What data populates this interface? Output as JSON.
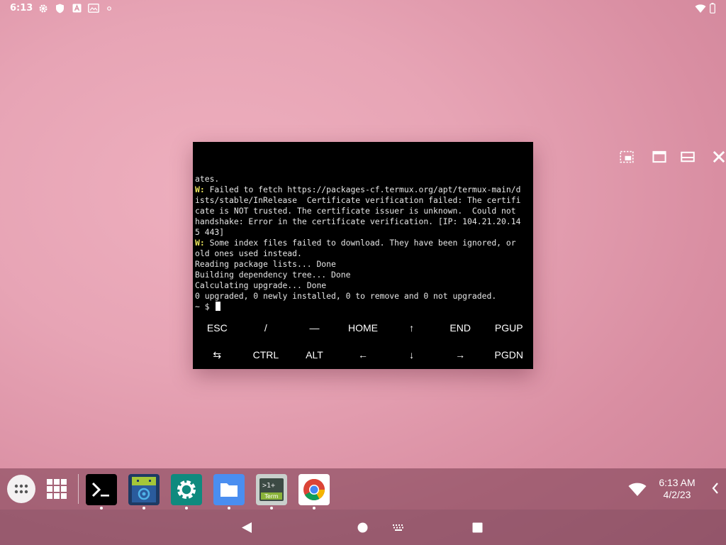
{
  "status_bar": {
    "time": "6:13",
    "icons": [
      "gear-icon",
      "shield-icon",
      "a-icon",
      "image-icon",
      "dot-icon",
      "wifi-icon",
      "battery-icon"
    ]
  },
  "terminal": {
    "lines": [
      {
        "prefix": "",
        "text": "ates."
      },
      {
        "prefix": "W:",
        "text": " Failed to fetch https://packages-cf.termux.org/apt/termux-main/d"
      },
      {
        "prefix": "",
        "text": "ists/stable/InRelease  Certificate verification failed: The certifi"
      },
      {
        "prefix": "",
        "text": "cate is NOT trusted. The certificate issuer is unknown.  Could not"
      },
      {
        "prefix": "",
        "text": "handshake: Error in the certificate verification. [IP: 104.21.20.14"
      },
      {
        "prefix": "",
        "text": "5 443]"
      },
      {
        "prefix": "W:",
        "text": " Some index files failed to download. They have been ignored, or"
      },
      {
        "prefix": "",
        "text": "old ones used instead."
      },
      {
        "prefix": "",
        "text": "Reading package lists... Done"
      },
      {
        "prefix": "",
        "text": "Building dependency tree... Done"
      },
      {
        "prefix": "",
        "text": "Calculating upgrade... Done"
      },
      {
        "prefix": "",
        "text": "0 upgraded, 0 newly installed, 0 to remove and 0 not upgraded."
      }
    ],
    "prompt": "~ $ "
  },
  "extra_keys": {
    "row1": [
      "ESC",
      "/",
      "—",
      "HOME",
      "↑",
      "END",
      "PGUP"
    ],
    "row2": [
      "⇆",
      "CTRL",
      "ALT",
      "←",
      "↓",
      "→",
      "PGDN"
    ]
  },
  "taskbar": {
    "apps": [
      "terminal-app-icon",
      "android-app-icon",
      "settings-app-icon",
      "files-app-icon",
      "term-app-icon",
      "chrome-app-icon"
    ],
    "term_icon_text": ">1+",
    "term_icon_label": "Term",
    "clock_time": "6:13 AM",
    "clock_date": "4/2/23"
  }
}
